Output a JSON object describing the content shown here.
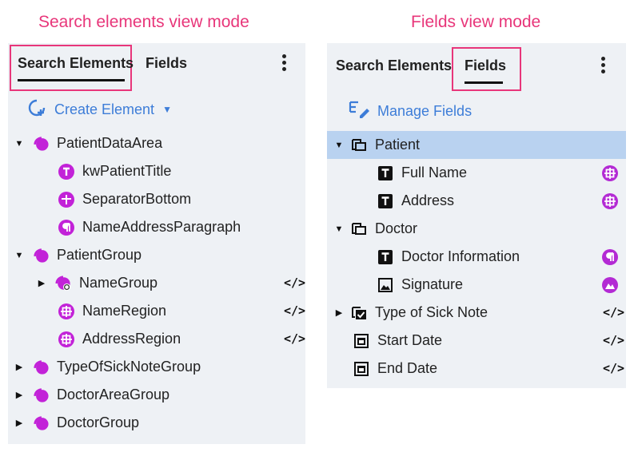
{
  "captions": {
    "left": "Search elements view mode",
    "right": "Fields view mode"
  },
  "colors": {
    "highlight": "#e8367a",
    "accent": "#3d7dd8",
    "element_icon": "#c222d8",
    "selection": "#b9d2f0",
    "panel_bg": "#eef1f5"
  },
  "left_panel": {
    "tabs": [
      "Search Elements",
      "Fields"
    ],
    "active_tab": "Search Elements",
    "create_element": "Create Element",
    "tree": [
      {
        "label": "PatientDataArea",
        "icon": "group-icon",
        "expanded": true
      },
      {
        "label": "kwPatientTitle",
        "icon": "text-icon"
      },
      {
        "label": "SeparatorBottom",
        "icon": "separator-icon"
      },
      {
        "label": "NameAddressParagraph",
        "icon": "paragraph-icon"
      },
      {
        "label": "PatientGroup",
        "icon": "group-icon",
        "expanded": true
      },
      {
        "label": "NameGroup",
        "icon": "linked-group-icon",
        "expanded": false,
        "code": "</>"
      },
      {
        "label": "NameRegion",
        "icon": "region-icon",
        "code": "</>"
      },
      {
        "label": "AddressRegion",
        "icon": "region-icon",
        "code": "</>"
      },
      {
        "label": "TypeOfSickNoteGroup",
        "icon": "group-icon",
        "expanded": false
      },
      {
        "label": "DoctorAreaGroup",
        "icon": "group-icon",
        "expanded": false
      },
      {
        "label": "DoctorGroup",
        "icon": "group-icon",
        "expanded": false
      }
    ]
  },
  "right_panel": {
    "tabs": [
      "Search Elements",
      "Fields"
    ],
    "active_tab": "Fields",
    "manage_fields": "Manage Fields",
    "tree": [
      {
        "label": "Patient",
        "icon": "field-group-icon",
        "expanded": true,
        "selected": true
      },
      {
        "label": "Full Name",
        "icon": "text-field-icon",
        "badge": "region-icon"
      },
      {
        "label": "Address",
        "icon": "text-field-icon",
        "badge": "region-icon"
      },
      {
        "label": "Doctor",
        "icon": "field-group-icon",
        "expanded": true
      },
      {
        "label": "Doctor Information",
        "icon": "text-field-icon",
        "badge": "paragraph-icon"
      },
      {
        "label": "Signature",
        "icon": "image-field-icon",
        "badge": "image-icon"
      },
      {
        "label": "Type of Sick Note",
        "icon": "checkbox-field-icon",
        "expanded": false,
        "code": "</>"
      },
      {
        "label": "Start Date",
        "icon": "date-field-icon",
        "code": "</>"
      },
      {
        "label": "End Date",
        "icon": "date-field-icon",
        "code": "</>"
      }
    ]
  }
}
